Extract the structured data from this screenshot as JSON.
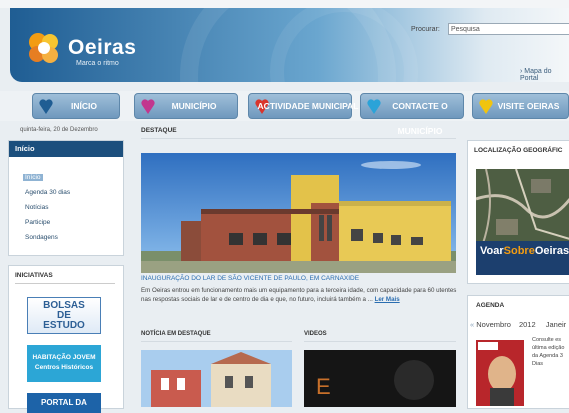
{
  "header": {
    "brand": "Oeiras",
    "tagline": "Marca o ritmo",
    "search_label": "Procurar:",
    "search_value": "Pesquisa",
    "map_link": "› Mapa do Portal"
  },
  "nav": [
    {
      "label": "INÍCIO",
      "heart_color": "#1f5d93"
    },
    {
      "label": "MUNICÍPIO",
      "heart_color": "#c2378e"
    },
    {
      "label": "ACTIVIDADE MUNICIPAL",
      "heart_color": "#d9352c"
    },
    {
      "label": "CONTACTE O MUNICÍPIO",
      "heart_color": "#2ba3d8"
    },
    {
      "label": "VISITE OEIRAS",
      "heart_color": "#f1c40f"
    }
  ],
  "date": "quinta-feira, 20 de Dezembro",
  "sidebar": {
    "title": "Início",
    "current": "Início",
    "items": [
      "Agenda 30 dias",
      "Notícias",
      "Participe",
      "Sondagens"
    ]
  },
  "iniciativas": {
    "title": "INICIATIVAS",
    "banner1": [
      "BOLSAS",
      "DE",
      "ESTUDO"
    ],
    "banner2": [
      "HABITAÇÃO JOVEM",
      "Centros Históricos"
    ],
    "banner3": "PORTAL DA"
  },
  "main": {
    "section": "DESTAQUE",
    "caption": "INAUGURAÇÃO DO LAR DE SÃO VICENTE DE PAULO, EM CARNAXIDE",
    "description": "Em Oeiras entrou em funcionamento mais um equipamento para a terceira idade, com capacidade para 60 utentes nas respostas sociais de lar e de centro de dia e que, no futuro, incluirá também a ...",
    "read_more": "Ler Mais",
    "news_title": "NOTÍCIA EM DESTAQUE",
    "videos_title": "VIDEOS"
  },
  "right": {
    "geo_title": "LOCALIZAÇÃO GEOGRÁFIC",
    "voar_brand_a": "Voar",
    "voar_brand_b": "Sobre",
    "voar_brand_c": "Oeiras",
    "agenda_title": "AGENDA",
    "month": "Novembro",
    "year": "2012",
    "next_month": "Janeir",
    "agenda_text": "Consulte es última edição da Agenda 3 Dias"
  }
}
